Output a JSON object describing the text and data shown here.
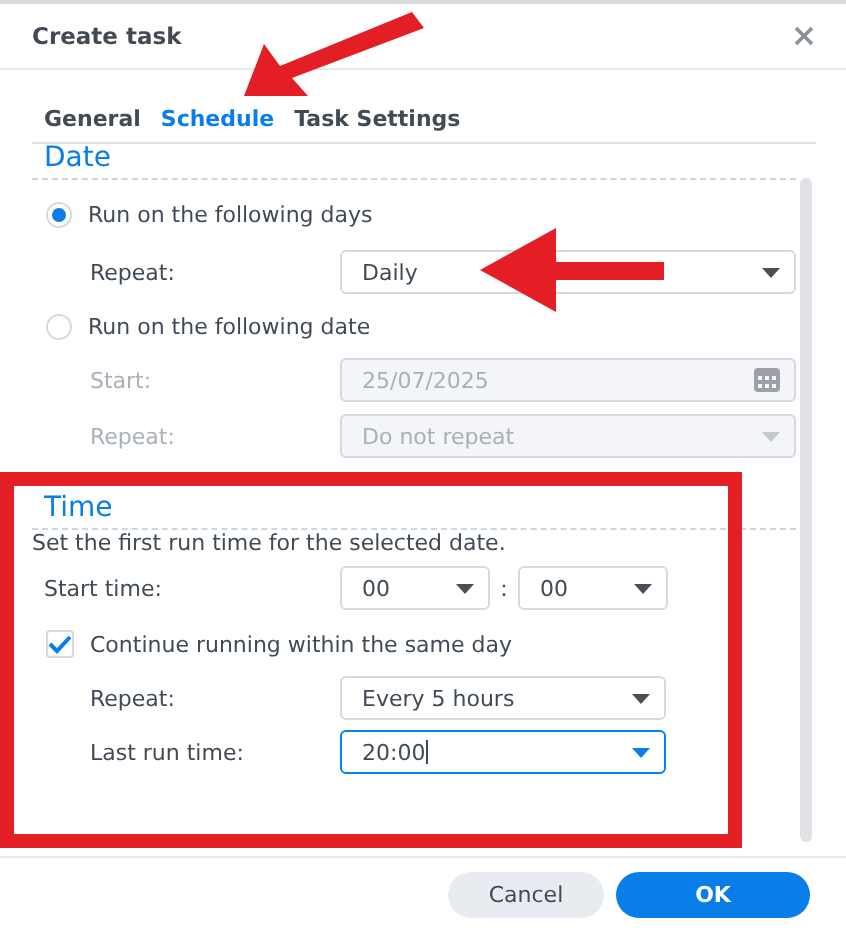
{
  "window": {
    "title": "Create task"
  },
  "tabs": [
    {
      "label": "General",
      "selected": false
    },
    {
      "label": "Schedule",
      "selected": true
    },
    {
      "label": "Task Settings",
      "selected": false
    }
  ],
  "date": {
    "heading": "Date",
    "options": [
      {
        "label": "Run on the following days",
        "selected": true,
        "fields": [
          {
            "label": "Repeat:",
            "value": "Daily",
            "kind": "select",
            "disabled": false
          }
        ]
      },
      {
        "label": "Run on the following date",
        "selected": false,
        "fields": [
          {
            "label": "Start:",
            "value": "25/07/2025",
            "kind": "date",
            "disabled": true
          },
          {
            "label": "Repeat:",
            "value": "Do not repeat",
            "kind": "select",
            "disabled": true
          }
        ]
      }
    ]
  },
  "time": {
    "heading": "Time",
    "hint": "Set the first run time for the selected date.",
    "start_time": {
      "label": "Start time:",
      "hour": "00",
      "separator": ":",
      "minute": "00"
    },
    "continue": {
      "label": "Continue running within the same day",
      "checked": true
    },
    "fields": [
      {
        "label": "Repeat:",
        "value": "Every 5 hours",
        "focused": false
      },
      {
        "label": "Last run time:",
        "value": "20:00",
        "focused": true
      }
    ]
  },
  "buttons": [
    {
      "label": "Cancel",
      "kind": "secondary"
    },
    {
      "label": "OK",
      "kind": "primary"
    }
  ]
}
